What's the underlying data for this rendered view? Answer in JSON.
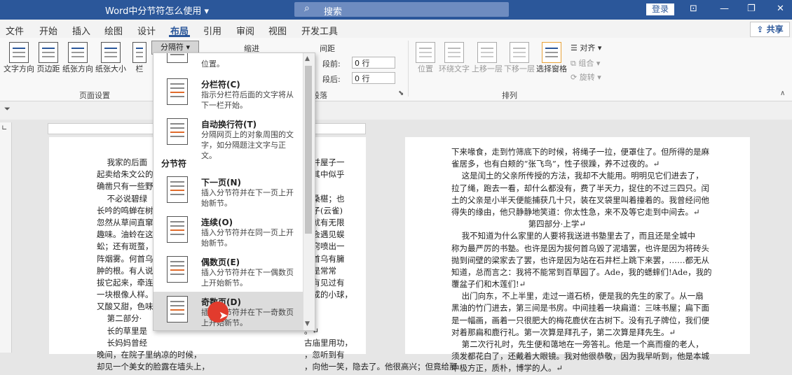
{
  "window": {
    "title": "Word中分节符怎么使用 ▾",
    "search_placeholder": "搜索",
    "login": "登录",
    "controls": [
      "⊡",
      "—",
      "❐",
      "✕"
    ]
  },
  "tabs": [
    "文件",
    "开始",
    "插入",
    "绘图",
    "设计",
    "布局",
    "引用",
    "审阅",
    "视图",
    "开发工具"
  ],
  "active_tab": "布局",
  "share": "共享",
  "ribbon": {
    "page_setup": {
      "buttons": [
        "文字方向",
        "页边距",
        "纸张方向",
        "纸张大小",
        "栏"
      ],
      "breaks_button": "分隔符 ▾",
      "group_label": "页面设置"
    },
    "paragraph": {
      "indent_label": "缩进",
      "spacing_label": "间距",
      "before_label": "段前:",
      "before_value": "0 行",
      "after_label": "段后:",
      "after_value": "0 行",
      "group_label": "段落"
    },
    "arrange": {
      "buttons": [
        "位置",
        "环绕文字",
        "上移一层",
        "下移一层",
        "选择窗格"
      ],
      "align": "对齐 ▾",
      "group": "组合 ▾",
      "rotate": "旋转 ▾",
      "group_label": "排列"
    }
  },
  "dropdown": {
    "top_desc": [
      "位置。"
    ],
    "column_break": {
      "title": "分栏符(C)",
      "desc": "指示分栏符后面的文字将从下一栏开始。"
    },
    "text_wrap": {
      "title": "自动换行符(T)",
      "desc": "分隔网页上的对象周围的文字，如分隔题注文字与正文。"
    },
    "section_header": "分节符",
    "next_page": {
      "title": "下一页(N)",
      "desc": "插入分节符并在下一页上开始新节。"
    },
    "continuous": {
      "title": "连续(O)",
      "desc": "插入分节符并在同一页上开始新节。"
    },
    "even_page": {
      "title": "偶数页(E)",
      "desc": "插入分节符并在下一偶数页上开始新节。"
    },
    "odd_page": {
      "title": "奇数页(D)",
      "desc": "插入分节符并在下一奇数页上开始新节。"
    }
  },
  "page1": {
    "lines": [
      "    我家的后面",
      "起卖给朱文公的",
      "确凿只有一些野",
      "    不必说碧绿",
      "长吟的鸣蝉在树",
      "忽然从草间直窜",
      "趣味。油蛉在这",
      "蚣；还有斑蝥，",
      "阵烟雾。何首乌",
      "肿的根。有人说",
      "拔它起来，牵连",
      "一块根像人样。",
      "又酸又甜，色味",
      "    第二部分·",
      "    长的草里是",
      "    长妈妈曾经",
      "晚间，在院子里纳凉的时候，",
      "却见一个美女的脸露在墙头上，"
    ],
    "right_lines": [
      "已并屋子一",
      "，其中似乎",
      "",
      "的桑椹；也",
      "天子(云雀)",
      "，就有无限",
      "，会遇见蜈",
      "后窍喷出一",
      "何首乌有臃",
      "于是常常",
      "没有见过有",
      "臃成的小球，",
      "",
      "",
      "。↵",
      "古庙里用功，",
      "，忽听到有",
      "，向他一笑，隐去了。他很高兴；但竟给那"
    ]
  },
  "page2": {
    "lines": [
      "下来喙食，走到竹筛底下的时候，将绳子一拉，便罩住了。但所得的是麻",
      "雀居多，也有白颊的“张飞鸟”，性子很躁，养不过夜的。↵",
      "    这是闰土的父亲所传授的方法，我却不大能用。明明见它们进去了，",
      "拉了绳，跑去一看，却什么都没有，费了半天力，捉住的不过三四只。闰",
      "土的父亲是小半天便能捕获几十只，装在叉袋里叫着撞着的。我曾经问他",
      "得失的缘由，他只静静地笑道：你太性急，来不及等它走到中间去。↵",
      "                              第四部分·上学↵",
      "    我不知道为什么家里的人要将我送进书塾里去了，而且还是全城中",
      "称为最严厉的书塾。也许是因为拔何首乌毁了泥墙罢，也许是因为将砖头",
      "抛到间壁的梁家去了罢，也许是因为站在石井栏上跳下来罢，……都无从",
      "知道，总而言之：我将不能常到百草园了。Ade，我的蟋蟀们!Ade，我的",
      "覆盆子们和木莲们!↵",
      "    出门向东，不上半里，走过一道石桥，便是我的先生的家了。从一扇",
      "黑油的竹门进去，第三间是书房。中间挂着一块扁道：三味书屋；扁下面",
      "是一幅画，画着一只很肥大的梅花鹿伏在古树下。没有孔子牌位，我们便",
      "对着那扁和鹿行礼。第一次算是拜孔子，第二次算是拜先生。↵",
      "    第二次行礼时，先生便和蔼地在一旁答礼。他是一个高而瘦的老人，",
      "须发都花白了，还戴着大眼镜。我对他很恭敬，因为我早听到，他是本城",
      "中极方正，质朴，博学的人。↵"
    ]
  }
}
